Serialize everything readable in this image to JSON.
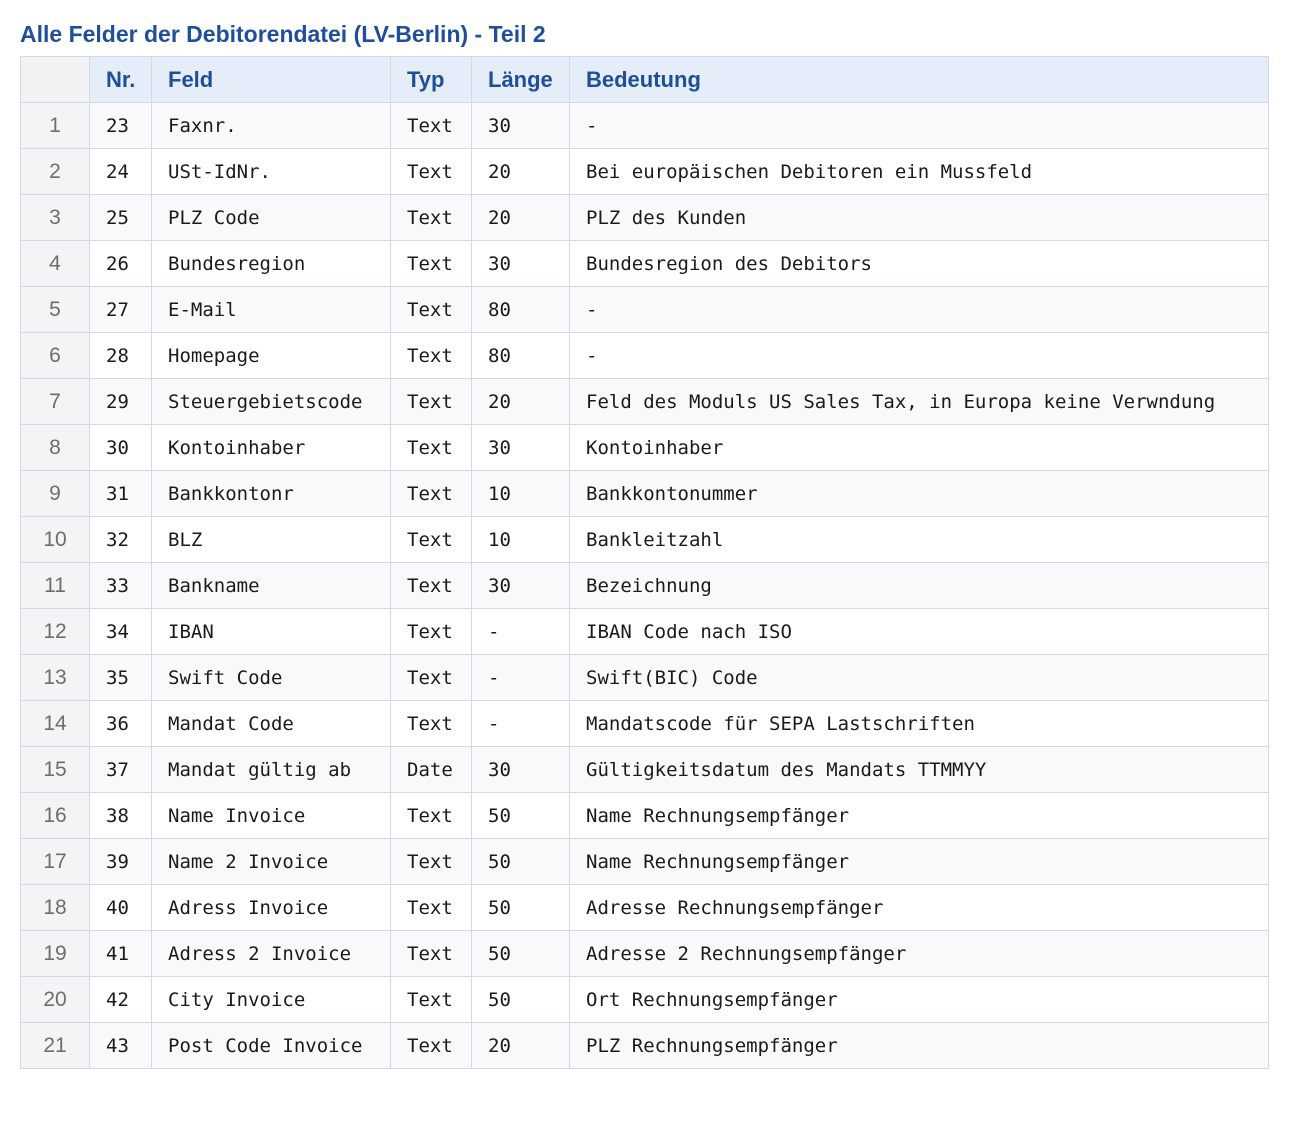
{
  "page": {
    "title": "Alle Felder der Debitorendatei (LV-Berlin) - Teil 2"
  },
  "table": {
    "columns": [
      "Nr.",
      "Feld",
      "Typ",
      "Länge",
      "Bedeutung"
    ],
    "rows": [
      {
        "index": "1",
        "nr": "23",
        "feld": "Faxnr.",
        "typ": "Text",
        "laenge": "30",
        "bedeutung": "-"
      },
      {
        "index": "2",
        "nr": "24",
        "feld": "USt-IdNr.",
        "typ": "Text",
        "laenge": "20",
        "bedeutung": "Bei europäischen Debitoren ein Mussfeld"
      },
      {
        "index": "3",
        "nr": "25",
        "feld": "PLZ Code",
        "typ": "Text",
        "laenge": "20",
        "bedeutung": "PLZ des Kunden"
      },
      {
        "index": "4",
        "nr": "26",
        "feld": "Bundesregion",
        "typ": "Text",
        "laenge": "30",
        "bedeutung": "Bundesregion des Debitors"
      },
      {
        "index": "5",
        "nr": "27",
        "feld": "E-Mail",
        "typ": "Text",
        "laenge": "80",
        "bedeutung": "-"
      },
      {
        "index": "6",
        "nr": "28",
        "feld": "Homepage",
        "typ": "Text",
        "laenge": "80",
        "bedeutung": "-"
      },
      {
        "index": "7",
        "nr": "29",
        "feld": "Steuergebietscode",
        "typ": "Text",
        "laenge": "20",
        "bedeutung": "Feld des Moduls US Sales Tax, in Europa keine Verwndung"
      },
      {
        "index": "8",
        "nr": "30",
        "feld": "Kontoinhaber",
        "typ": "Text",
        "laenge": "30",
        "bedeutung": "Kontoinhaber"
      },
      {
        "index": "9",
        "nr": "31",
        "feld": "Bankkontonr",
        "typ": "Text",
        "laenge": "10",
        "bedeutung": "Bankkontonummer"
      },
      {
        "index": "10",
        "nr": "32",
        "feld": "BLZ",
        "typ": "Text",
        "laenge": "10",
        "bedeutung": "Bankleitzahl"
      },
      {
        "index": "11",
        "nr": "33",
        "feld": "Bankname",
        "typ": "Text",
        "laenge": "30",
        "bedeutung": "Bezeichnung"
      },
      {
        "index": "12",
        "nr": "34",
        "feld": "IBAN",
        "typ": "Text",
        "laenge": "-",
        "bedeutung": "IBAN Code nach ISO"
      },
      {
        "index": "13",
        "nr": "35",
        "feld": "Swift Code",
        "typ": "Text",
        "laenge": "-",
        "bedeutung": "Swift(BIC) Code"
      },
      {
        "index": "14",
        "nr": "36",
        "feld": "Mandat Code",
        "typ": "Text",
        "laenge": "-",
        "bedeutung": "Mandatscode für SEPA Lastschriften"
      },
      {
        "index": "15",
        "nr": "37",
        "feld": "Mandat gültig ab",
        "typ": "Date",
        "laenge": "30",
        "bedeutung": "Gültigkeitsdatum des Mandats TTMMYY"
      },
      {
        "index": "16",
        "nr": "38",
        "feld": "Name Invoice",
        "typ": "Text",
        "laenge": "50",
        "bedeutung": "Name Rechnungsempfänger"
      },
      {
        "index": "17",
        "nr": "39",
        "feld": "Name 2 Invoice",
        "typ": "Text",
        "laenge": "50",
        "bedeutung": "Name Rechnungsempfänger"
      },
      {
        "index": "18",
        "nr": "40",
        "feld": "Adress Invoice",
        "typ": "Text",
        "laenge": "50",
        "bedeutung": "Adresse Rechnungsempfänger"
      },
      {
        "index": "19",
        "nr": "41",
        "feld": "Adress 2 Invoice",
        "typ": "Text",
        "laenge": "50",
        "bedeutung": "Adresse 2 Rechnungsempfänger"
      },
      {
        "index": "20",
        "nr": "42",
        "feld": "City Invoice",
        "typ": "Text",
        "laenge": "50",
        "bedeutung": "Ort Rechnungsempfänger"
      },
      {
        "index": "21",
        "nr": "43",
        "feld": "Post Code Invoice",
        "typ": "Text",
        "laenge": "20",
        "bedeutung": "PLZ Rechnungsempfänger"
      }
    ]
  }
}
